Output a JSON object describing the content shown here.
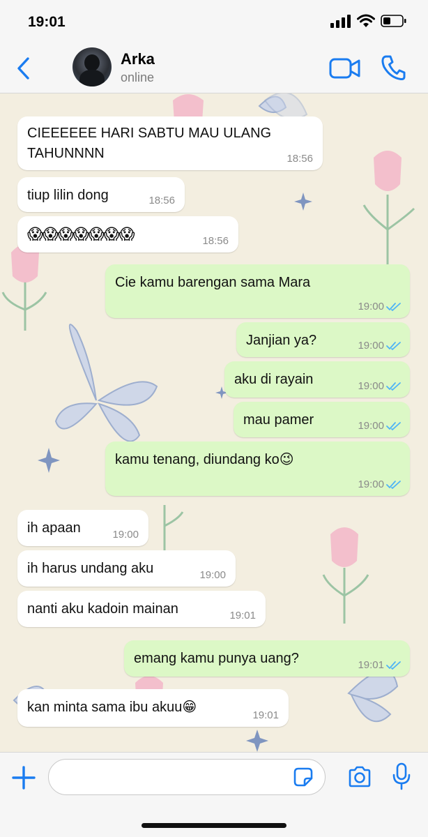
{
  "status_bar": {
    "time": "19:01"
  },
  "header": {
    "contact_name": "Arka",
    "contact_status": "online"
  },
  "colors": {
    "accent": "#1a7cf0",
    "incoming_bubble": "#ffffff",
    "outgoing_bubble": "#dcf8c6",
    "read_ticks": "#4fb3f6"
  },
  "messages": [
    {
      "direction": "in",
      "lines": [
        "CIEEEEEE HARI SABTU MAU ULANG",
        "TAHUNNNN"
      ],
      "time": "18:56"
    },
    {
      "direction": "in",
      "text": "tiup lilin dong",
      "time": "18:56"
    },
    {
      "direction": "in",
      "text": "😱😱😱😱😱😱😱",
      "time": "18:56"
    },
    {
      "direction": "out",
      "text": "Cie kamu barengan sama Mara",
      "time": "19:00",
      "status": "read"
    },
    {
      "direction": "out",
      "text": "Janjian ya?",
      "time": "19:00",
      "status": "read"
    },
    {
      "direction": "out",
      "text": "aku di rayain",
      "time": "19:00",
      "status": "read"
    },
    {
      "direction": "out",
      "text": "mau pamer",
      "time": "19:00",
      "status": "read"
    },
    {
      "direction": "out",
      "text": "kamu tenang, diundang ko😉",
      "time": "19:00",
      "status": "read"
    },
    {
      "direction": "in",
      "text": "ih apaan",
      "time": "19:00"
    },
    {
      "direction": "in",
      "text": "ih harus undang aku",
      "time": "19:00"
    },
    {
      "direction": "in",
      "text": "nanti aku kadoin mainan",
      "time": "19:01"
    },
    {
      "direction": "out",
      "text": "emang kamu punya uang?",
      "time": "19:01",
      "status": "read"
    },
    {
      "direction": "in",
      "text": "kan minta sama ibu akuu😁",
      "time": "19:01"
    }
  ],
  "composer": {
    "value": "",
    "placeholder": ""
  },
  "icons": [
    "back-chevron-icon",
    "video-call-icon",
    "phone-icon",
    "plus-icon",
    "sticker-icon",
    "camera-icon",
    "microphone-icon"
  ]
}
